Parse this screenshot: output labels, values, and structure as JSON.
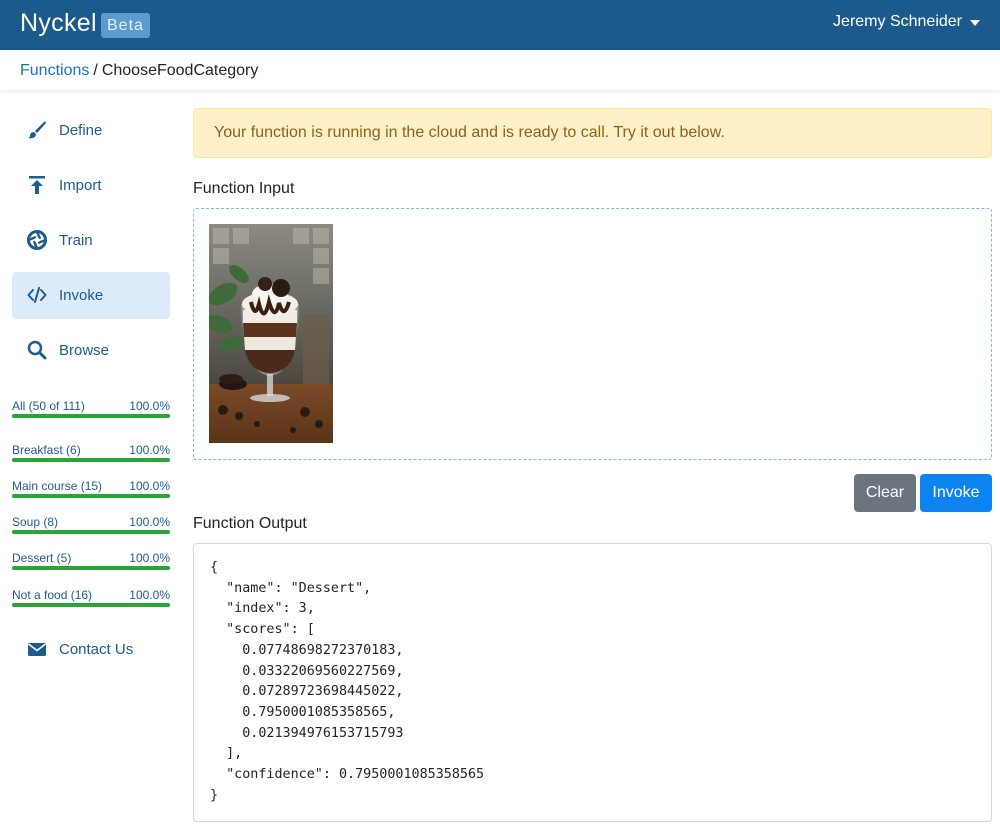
{
  "navbar": {
    "brand": "Nyckel",
    "badge": "Beta",
    "user_name": "Jeremy Schneider"
  },
  "breadcrumb": {
    "parent": "Functions",
    "separator": "/",
    "current": "ChooseFoodCategory"
  },
  "sidebar": {
    "nav": [
      {
        "label": "Define",
        "icon": "brush-icon"
      },
      {
        "label": "Import",
        "icon": "upload-icon"
      },
      {
        "label": "Train",
        "icon": "aperture-icon"
      },
      {
        "label": "Invoke",
        "icon": "code-icon",
        "active": true
      },
      {
        "label": "Browse",
        "icon": "search-icon"
      }
    ],
    "categories": [
      {
        "label": "All (50 of 111)",
        "percent": "100.0%",
        "progress": 1.0
      },
      {
        "label": "Breakfast (6)",
        "percent": "100.0%",
        "progress": 1.0
      },
      {
        "label": "Main course (15)",
        "percent": "100.0%",
        "progress": 1.0
      },
      {
        "label": "Soup (8)",
        "percent": "100.0%",
        "progress": 1.0
      },
      {
        "label": "Dessert (5)",
        "percent": "100.0%",
        "progress": 1.0
      },
      {
        "label": "Not a food (16)",
        "percent": "100.0%",
        "progress": 1.0
      }
    ],
    "contact": {
      "label": "Contact Us",
      "icon": "envelope-icon"
    }
  },
  "main": {
    "alert": "Your function is running in the cloud and is ready to call. Try it out below.",
    "input_title": "Function Input",
    "clear_label": "Clear",
    "invoke_label": "Invoke",
    "output_title": "Function Output",
    "output_json": "{\n  \"name\": \"Dessert\",\n  \"index\": 3,\n  \"scores\": [\n    0.07748698272370183,\n    0.03322069560227569,\n    0.07289723698445022,\n    0.7950001085358565,\n    0.021394976153715793\n  ],\n  \"confidence\": 0.7950001085358565\n}"
  },
  "colors": {
    "navbar": "#1c5a8c",
    "link": "#1a6fc4",
    "progress": "#2aa536",
    "alert_bg": "#fdf0c8",
    "invoke_button": "#0d83f2",
    "clear_button": "#6c757d"
  }
}
